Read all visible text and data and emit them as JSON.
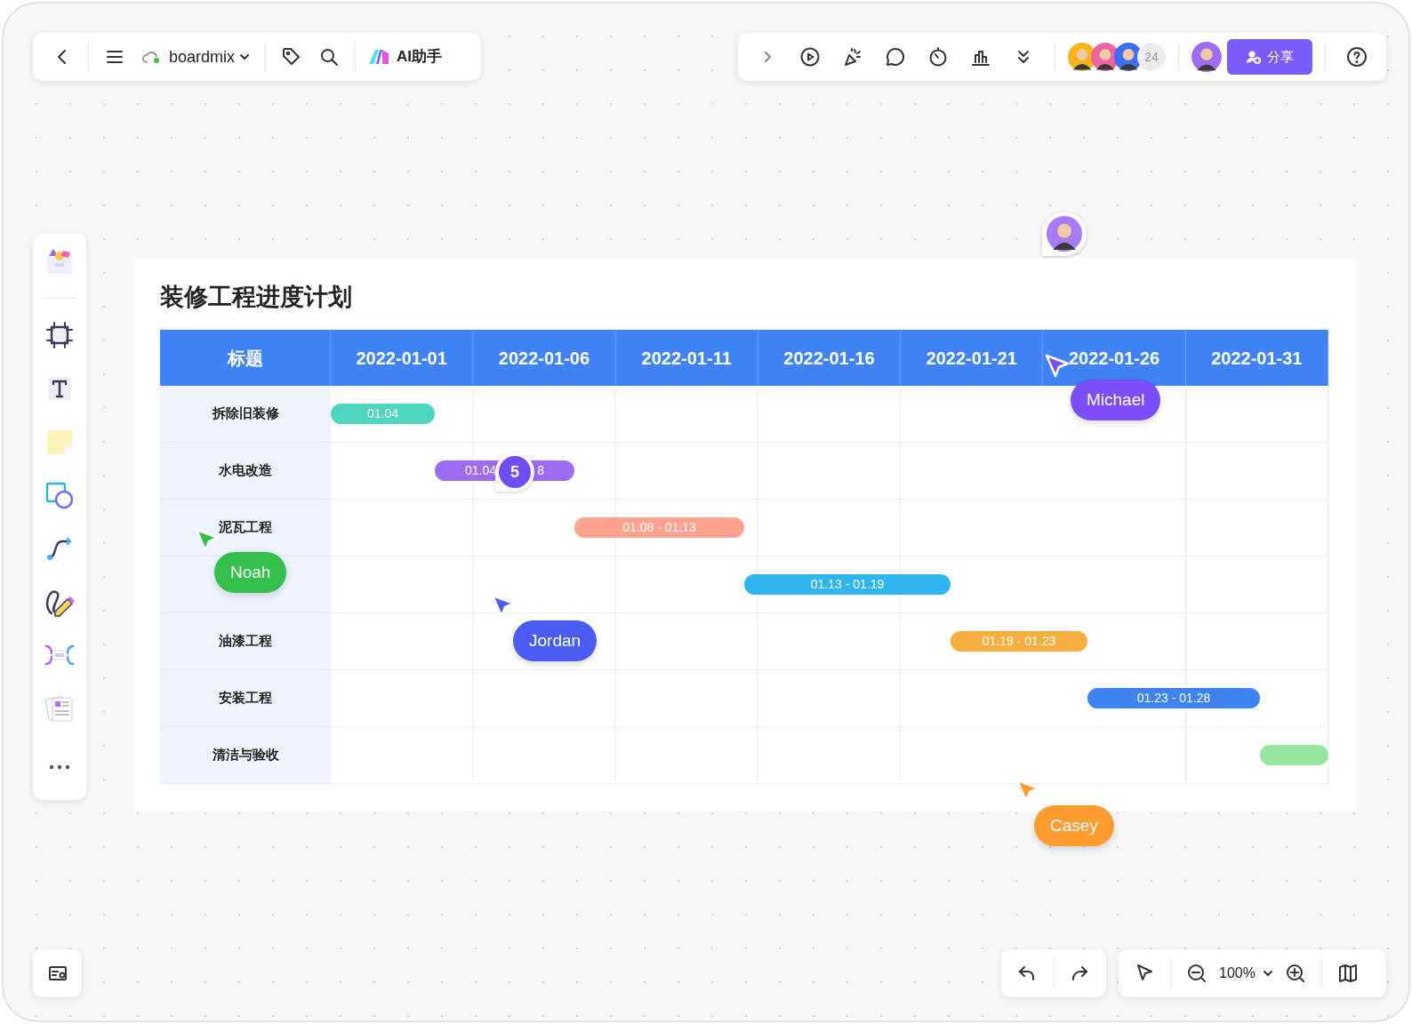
{
  "toolbar": {
    "file_name": "boardmix",
    "ai_label": "AI助手",
    "collaborator_count": "24",
    "share_label": "分享"
  },
  "board": {
    "title": "装修工程进度计划",
    "header_label": "标题",
    "columns": [
      "2022-01-01",
      "2022-01-06",
      "2022-01-11",
      "2022-01-16",
      "2022-01-21",
      "2022-01-26",
      "2022-01-31"
    ],
    "rows": [
      {
        "label": "拆除旧装修",
        "bar": {
          "color": "#4dd6bd",
          "label": "01.04"
        }
      },
      {
        "label": "水电改造",
        "bar": {
          "color": "#9d6cf1",
          "label": "01.04",
          "label_tail": "8"
        }
      },
      {
        "label": "泥瓦工程",
        "bar": {
          "color": "#ffa390",
          "label": "01.08 - 01.13"
        }
      },
      {
        "bar": {
          "color": "#2fb6ef",
          "label": "01.13 - 01.19"
        }
      },
      {
        "label": "油漆工程",
        "bar": {
          "color": "#f6ae3f",
          "label": "01.19 - 01.23"
        }
      },
      {
        "label": "安装工程",
        "bar": {
          "color": "#3d84f2",
          "label": "01.23 - 01.28"
        }
      },
      {
        "label": "清洁与验收",
        "bar": {
          "color": "#97e49c"
        }
      }
    ]
  },
  "comment": {
    "count": "5"
  },
  "cursors": [
    {
      "name": "Michael",
      "color": "#7b4dfb"
    },
    {
      "name": "Noah",
      "color": "#34c14b"
    },
    {
      "name": "Jordan",
      "color": "#4a5cf2"
    },
    {
      "name": "Casey",
      "color": "#ff9b2f"
    }
  ],
  "zoom": {
    "value": "100%"
  }
}
